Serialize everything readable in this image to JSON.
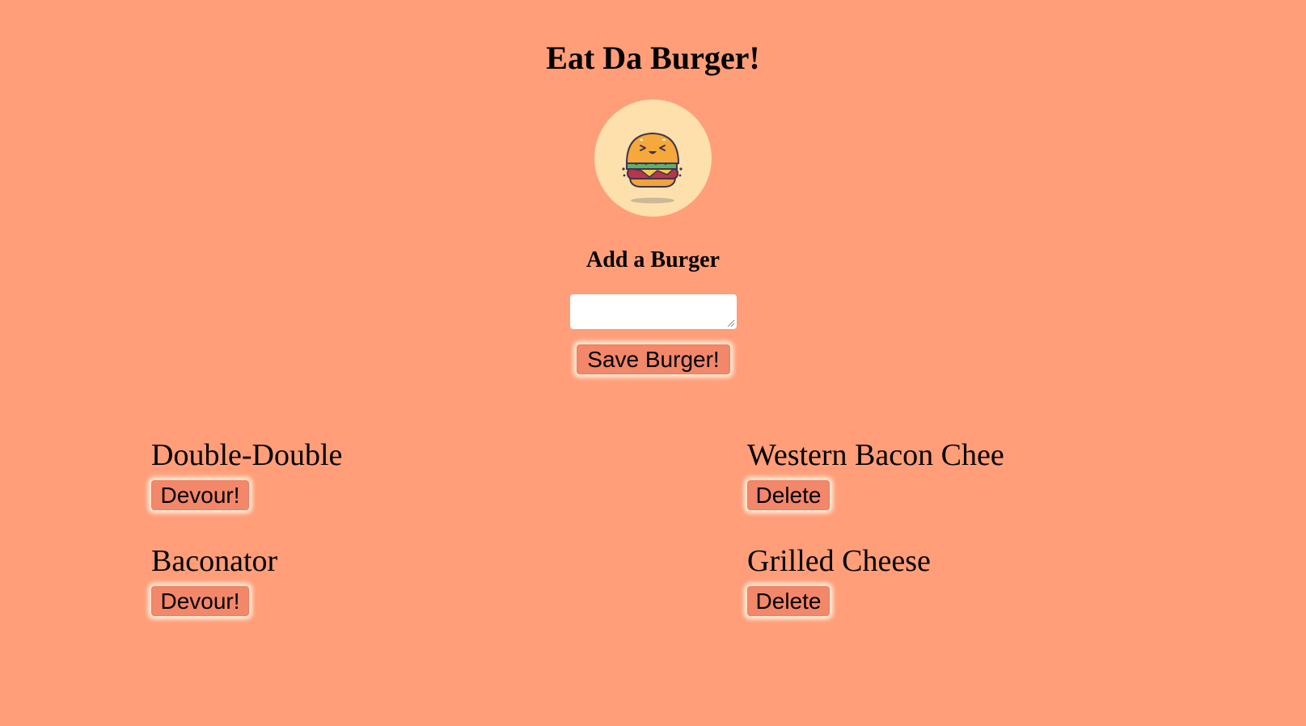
{
  "page": {
    "title": "Eat Da Burger!",
    "background_color": "#ff9e79"
  },
  "logo": {
    "icon": "burger-mascot-icon",
    "background_color": "#fde0ac"
  },
  "add_form": {
    "heading": "Add a Burger",
    "input_value": "",
    "save_label": "Save Burger!",
    "button_color": "#f2876a"
  },
  "uneaten": [
    {
      "name": "Double-Double",
      "action_label": "Devour!"
    },
    {
      "name": "Baconator",
      "action_label": "Devour!"
    }
  ],
  "devoured": [
    {
      "name": "Western Bacon Chee",
      "action_label": "Delete"
    },
    {
      "name": "Grilled Cheese",
      "action_label": "Delete"
    }
  ]
}
